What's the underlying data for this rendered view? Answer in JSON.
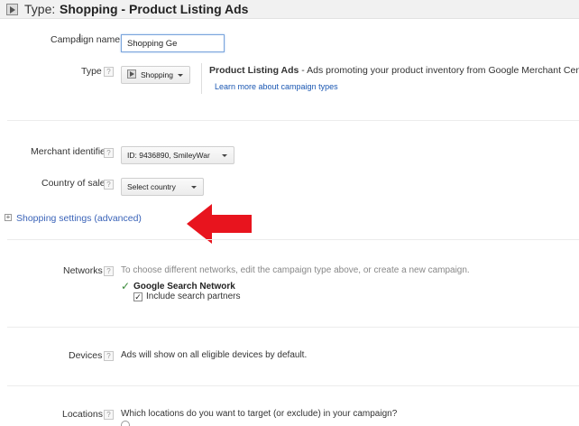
{
  "header": {
    "type_prefix": "Type:",
    "type_value": "Shopping - Product Listing Ads"
  },
  "campaign_name": {
    "label": "Campaign name",
    "value": "Shopping Ge"
  },
  "type": {
    "label": "Type",
    "help": "?",
    "dropdown_label": "Shopping",
    "title": "Product Listing Ads",
    "description": " - Ads promoting your product inventory from Google Merchant Center",
    "learn_more": "Learn more about campaign types"
  },
  "merchant": {
    "label": "Merchant identifier",
    "help": "?",
    "value": "ID: 9436890, SmileyWar"
  },
  "country": {
    "label": "Country of sale",
    "help": "?",
    "value": "Select country"
  },
  "advanced": {
    "toggle": "⊞",
    "label": "Shopping settings (advanced)"
  },
  "networks": {
    "label": "Networks",
    "help": "?",
    "instruction": "To choose different networks, edit the campaign type above, or create a new campaign.",
    "check_mark": "✓",
    "network_name": "Google Search Network",
    "checkbox_mark": "✓",
    "partners_label": "Include search partners"
  },
  "devices": {
    "label": "Devices",
    "help": "?",
    "text": "Ads will show on all eligible devices by default."
  },
  "locations": {
    "label": "Locations",
    "help": "?",
    "question": "Which locations do you want to target (or exclude) in your campaign?"
  },
  "colors": {
    "link": "#1a57b2",
    "arrow": "#e8141e",
    "check": "#3a8a3a"
  }
}
